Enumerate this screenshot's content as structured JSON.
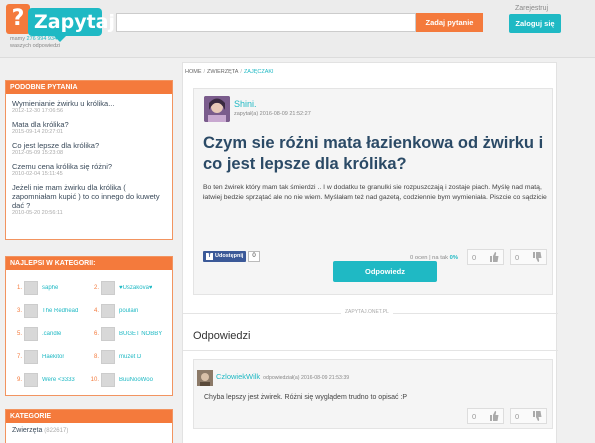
{
  "header": {
    "logo_q": "?",
    "logo_text": "Zapytaj",
    "subline_prefix": "mamy",
    "subline_count": "276 994 934",
    "subline_suffix": "waszych odpowiedzi",
    "search_placeholder": "",
    "ask_label": "Zadaj pytanie",
    "register_label": "Zarejestruj",
    "login_label": "Zaloguj się"
  },
  "similar": {
    "heading": "PODOBNE PYTANIA",
    "items": [
      {
        "title": "Wymienianie żwirku u królika...",
        "date": "2012-12-30 17:06:56"
      },
      {
        "title": "Mata dla królika?",
        "date": "2015-09-14 20:27:01"
      },
      {
        "title": "Co jest lepsze dla królika?",
        "date": "2012-05-09 15:23:08"
      },
      {
        "title": "Czemu cena królika się różni?",
        "date": "2010-02-04 15:11:45"
      },
      {
        "title": "Jeżeli nie mam żwirku dla królika ( zapomniałam kupić ) to co innego do kuwety dać ?",
        "date": "2010-05-20 20:56:11"
      }
    ]
  },
  "best": {
    "heading": "NAJLEPSI W KATEGORII:",
    "users": [
      {
        "rank": "1.",
        "name": "saphe"
      },
      {
        "rank": "2.",
        "name": "♥Uszakova♥"
      },
      {
        "rank": "3.",
        "name": "The Redhead"
      },
      {
        "rank": "4.",
        "name": "poulain"
      },
      {
        "rank": "5.",
        "name": ".candle"
      },
      {
        "rank": "6.",
        "name": "BUGET NOBBY"
      },
      {
        "rank": "7.",
        "name": "Haekitor"
      },
      {
        "rank": "8.",
        "name": "muzet D"
      },
      {
        "rank": "9.",
        "name": "Were <3333"
      },
      {
        "rank": "10.",
        "name": "BuuNooWoo"
      }
    ]
  },
  "categories": {
    "heading": "KATEGORIE",
    "items": [
      {
        "name": "Zwierzęta",
        "count": "(822617)"
      }
    ]
  },
  "breadcrumb": {
    "home": "HOME",
    "sep": "/",
    "cat": "ZWIERZĘTA",
    "current": "ZAJĘCZAKI"
  },
  "question": {
    "user": "Shini.",
    "meta": "zapytał(a) 2016-08-09 21:52:27",
    "title": "Czym sie różni mata łazienkowa od żwirku i co jest lepsze dla królika?",
    "body": "Bo ten żwirek który mam tak śmierdzi .. I w dodatku te granulki sie rozpuszczają i zostaje piach. Myślę nad matą, łatwiej bedzie sprzątać ale no nie wiem. Myślałam też nad gazetą, codziennie bym wymieniała. Piszcie co sądzicie",
    "share_label": "Udostępnij",
    "share_count": "0",
    "rating_count": "0",
    "rating_label": "ocen",
    "rating_sep": "| na tak",
    "rating_pct": "0%",
    "likes": "0",
    "dislikes": "0",
    "answer_label": "Odpowiedz"
  },
  "divider_label": "ZAPYTAJ.ONET.PL",
  "answers": {
    "heading": "Odpowiedzi",
    "items": [
      {
        "user": "CzlowiekWilk",
        "meta": "odpowiedział(a) 2016-08-09 21:53:39",
        "body": "Chyba lepszy jest żwirek. Różni się wyglądem trudno to opisać :P",
        "likes": "0",
        "dislikes": "0"
      }
    ]
  },
  "colors": {
    "orange": "#f47a3c",
    "teal": "#1fb9c4",
    "title_blue": "#2b4a66"
  },
  "icons": [
    "question-mark-icon",
    "facebook-icon",
    "thumb-up-icon",
    "thumb-down-icon"
  ]
}
